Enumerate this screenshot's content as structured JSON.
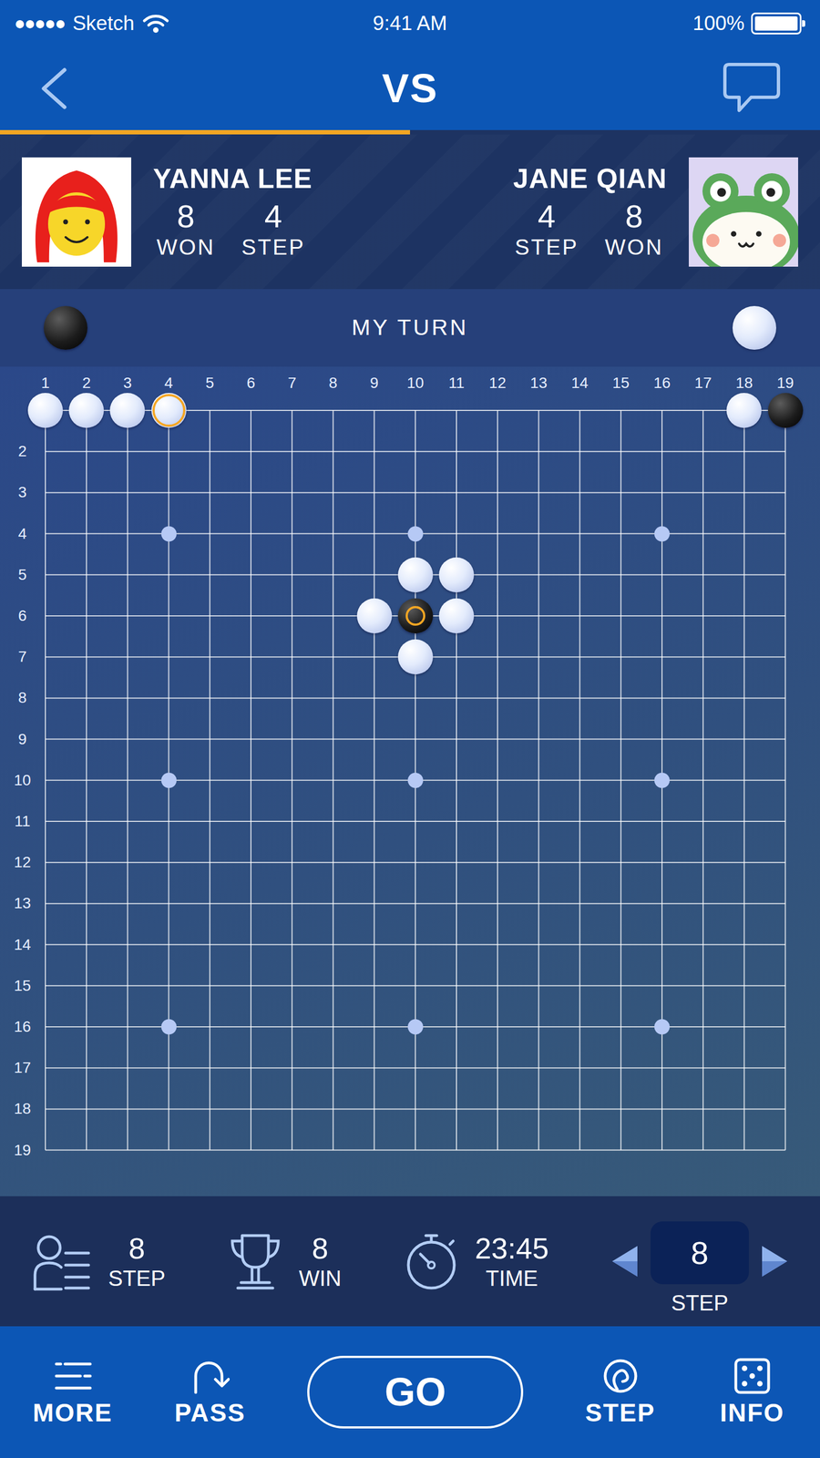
{
  "status_bar": {
    "signal": "●●●●●",
    "carrier": "Sketch",
    "time": "9:41 AM",
    "battery": "100%",
    "battery_level": 1
  },
  "nav": {
    "title": "VS",
    "progress": 0.5
  },
  "players": [
    {
      "name": "YANNA LEE",
      "won": "8",
      "won_label": "WON",
      "step": "4",
      "step_label": "STEP"
    },
    {
      "name": "JANE QIAN",
      "won": "8",
      "won_label": "WON",
      "step": "4",
      "step_label": "STEP"
    }
  ],
  "turn": {
    "label": "MY TURN",
    "my_stone": "black",
    "opponent_stone": "white"
  },
  "board": {
    "columns": [
      "1",
      "2",
      "3",
      "4",
      "5",
      "6",
      "7",
      "8",
      "9",
      "10",
      "11",
      "12",
      "13",
      "14",
      "15",
      "16",
      "17",
      "18",
      "19"
    ],
    "rows": [
      "2",
      "3",
      "4",
      "5",
      "6",
      "7",
      "8",
      "9",
      "10",
      "11",
      "12",
      "13",
      "14",
      "15",
      "16",
      "17",
      "18",
      "19"
    ],
    "star_points": [
      {
        "row": 4,
        "col": 4
      },
      {
        "row": 4,
        "col": 10
      },
      {
        "row": 4,
        "col": 16
      },
      {
        "row": 10,
        "col": 4
      },
      {
        "row": 10,
        "col": 10
      },
      {
        "row": 10,
        "col": 16
      },
      {
        "row": 16,
        "col": 4
      },
      {
        "row": 16,
        "col": 10
      },
      {
        "row": 16,
        "col": 16
      }
    ],
    "stones": [
      {
        "row": 1,
        "col": 1,
        "kind": "white",
        "marked": false
      },
      {
        "row": 1,
        "col": 2,
        "kind": "white",
        "marked": false
      },
      {
        "row": 1,
        "col": 3,
        "kind": "white",
        "marked": false
      },
      {
        "row": 1,
        "col": 4,
        "kind": "ghost",
        "marked": true
      },
      {
        "row": 1,
        "col": 18,
        "kind": "white",
        "marked": false
      },
      {
        "row": 1,
        "col": 19,
        "kind": "black",
        "marked": false
      },
      {
        "row": 5,
        "col": 10,
        "kind": "white",
        "marked": false
      },
      {
        "row": 5,
        "col": 11,
        "kind": "white",
        "marked": false
      },
      {
        "row": 6,
        "col": 9,
        "kind": "white",
        "marked": false
      },
      {
        "row": 6,
        "col": 10,
        "kind": "black",
        "marked": true
      },
      {
        "row": 6,
        "col": 11,
        "kind": "white",
        "marked": false
      },
      {
        "row": 7,
        "col": 10,
        "kind": "white",
        "marked": false
      }
    ]
  },
  "stats": [
    {
      "value": "8",
      "label": "STEP"
    },
    {
      "value": "8",
      "label": "WIN"
    },
    {
      "value": "23:45",
      "label": "TIME"
    }
  ],
  "step_picker": {
    "value": "8",
    "label": "STEP"
  },
  "toolbar": [
    {
      "label": "MORE",
      "kind": "icon"
    },
    {
      "label": "PASS",
      "kind": "icon"
    },
    {
      "label": "GO",
      "kind": "pill"
    },
    {
      "label": "STEP",
      "kind": "icon"
    },
    {
      "label": "INFO",
      "kind": "icon"
    }
  ]
}
